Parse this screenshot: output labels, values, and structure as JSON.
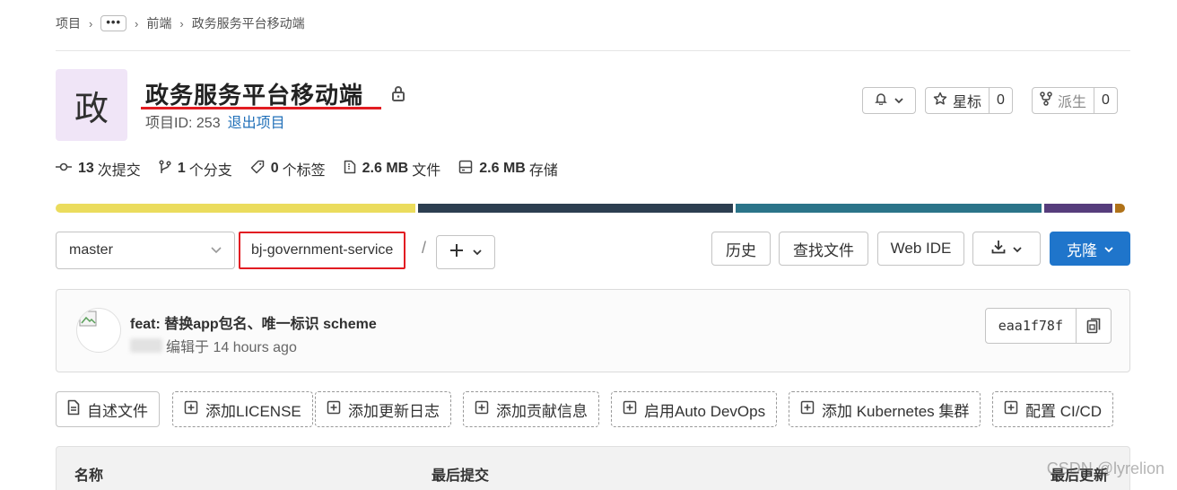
{
  "breadcrumb": {
    "root": "项目",
    "ellipsis": "•••",
    "group": "前端",
    "current": "政务服务平台移动端"
  },
  "project": {
    "avatar_letter": "政",
    "title": "政务服务平台移动端",
    "id_text": "项目ID: 253",
    "leave_label": "退出项目"
  },
  "header_actions": {
    "star_label": "星标",
    "star_count": "0",
    "fork_label": "派生",
    "fork_count": "0"
  },
  "stats": {
    "commits": {
      "value": "13",
      "label": "次提交"
    },
    "branches": {
      "value": "1",
      "label": "个分支"
    },
    "tags": {
      "value": "0",
      "label": "个标签"
    },
    "files": {
      "value": "2.6 MB",
      "label": "文件"
    },
    "storage": {
      "value": "2.6 MB",
      "label": "存储"
    }
  },
  "language_bar": {
    "colors": [
      "#ebdc5d",
      "#2c3e50",
      "#2b7489",
      "#563d7c",
      "#b07219"
    ],
    "shares": [
      0.338,
      0.296,
      0.288,
      0.064,
      0.009
    ]
  },
  "repo_nav": {
    "branch": "master",
    "path": "bj-government-service",
    "path_separator": "/",
    "history_label": "历史",
    "find_file_label": "查找文件",
    "web_ide_label": "Web IDE",
    "clone_label": "克隆"
  },
  "last_commit": {
    "message": "feat: 替换app包名、唯一标识 scheme",
    "meta": "编辑于 14 hours ago",
    "sha": "eaa1f78f"
  },
  "quick_actions": [
    "自述文件",
    "添加LICENSE",
    "添加更新日志",
    "添加贡献信息",
    "启用Auto DevOps",
    "添加 Kubernetes 集群",
    "配置 CI/CD"
  ],
  "table": {
    "col_name": "名称",
    "col_last_commit": "最后提交",
    "col_last_update": "最后更新"
  },
  "watermark": "CSDN @lyrelion",
  "colors": {
    "primary": "#1f75cb",
    "highlight": "#e21c22",
    "link": "#1f6fb8"
  }
}
